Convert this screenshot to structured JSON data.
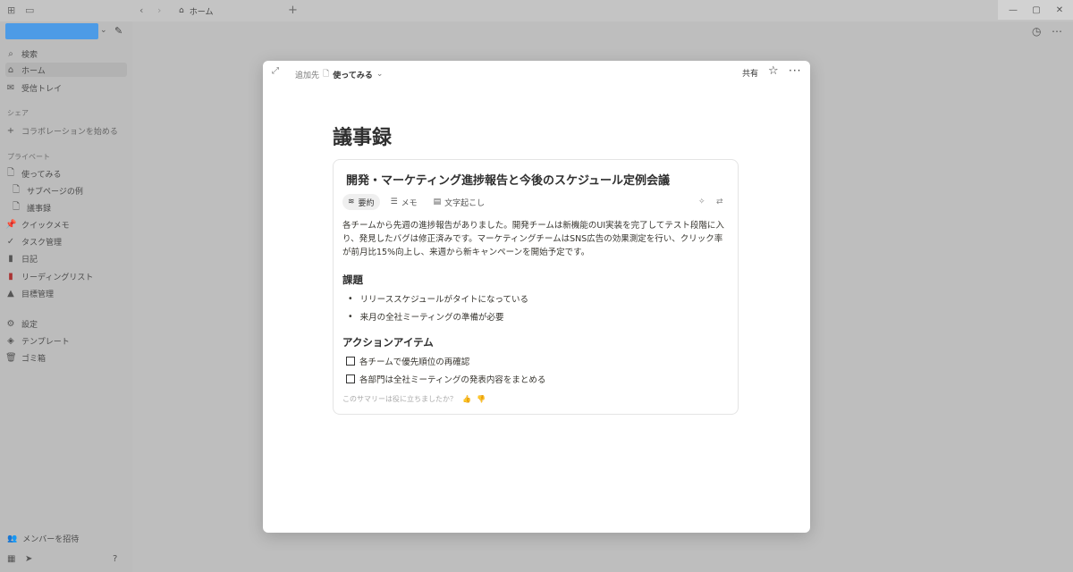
{
  "titlebar": {
    "tab_label": "ホーム",
    "new_tab": "+"
  },
  "sidebar": {
    "items_top": [
      {
        "label": "検索",
        "icon": "search-icon"
      },
      {
        "label": "ホーム",
        "icon": "home-icon"
      },
      {
        "label": "受信トレイ",
        "icon": "inbox-icon"
      }
    ],
    "section_share": "シェア",
    "collab": "コラボレーションを始める",
    "section_private": "プライベート",
    "pages": [
      {
        "label": "使ってみる",
        "icon": "page-icon"
      },
      {
        "label": "サブページの例",
        "icon": "page-icon"
      },
      {
        "label": "議事録",
        "icon": "page-icon"
      },
      {
        "label": "クイックメモ",
        "icon": "pin-icon"
      },
      {
        "label": "タスク管理",
        "icon": "check-icon"
      },
      {
        "label": "日記",
        "icon": "book-icon"
      },
      {
        "label": "リーディングリスト",
        "icon": "book-icon"
      },
      {
        "label": "目標管理",
        "icon": "mountain-icon"
      }
    ],
    "settings": [
      {
        "label": "設定",
        "icon": "gear-icon"
      },
      {
        "label": "テンプレート",
        "icon": "template-icon"
      },
      {
        "label": "ゴミ箱",
        "icon": "trash-icon"
      }
    ],
    "invite": "メンバーを招待"
  },
  "modal": {
    "breadcrumb_prefix": "追加先",
    "breadcrumb_page": "使ってみる",
    "share": "共有",
    "page_title": "議事録",
    "card": {
      "title": "開発・マーケティング進捗報告と今後のスケジュール定例会議",
      "tabs": [
        "要約",
        "メモ",
        "文字起こし"
      ],
      "summary": "各チームから先週の進捗報告がありました。開発チームは新機能のUI実装を完了してテスト段階に入り、発見したバグは修正済みです。マーケティングチームはSNS広告の効果測定を行い、クリック率が前月比15%向上し、来週から新キャンペーンを開始予定です。",
      "issues_heading": "課題",
      "issues": [
        "リリーススケジュールがタイトになっている",
        "来月の全社ミーティングの準備が必要"
      ],
      "actions_heading": "アクションアイテム",
      "actions": [
        "各チームで優先順位の再確認",
        "各部門は全社ミーティングの発表内容をまとめる"
      ],
      "feedback": "このサマリーは役に立ちましたか？"
    }
  }
}
